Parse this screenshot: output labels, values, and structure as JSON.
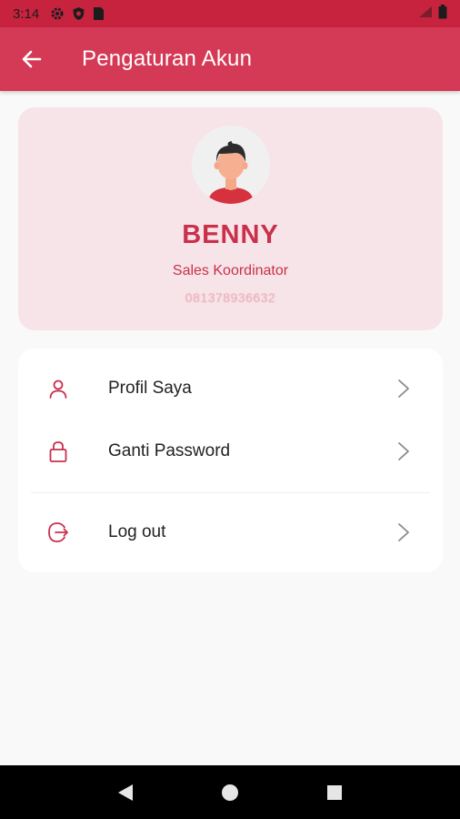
{
  "status_bar": {
    "time": "3:14",
    "icons": [
      "settings-icon",
      "shield-icon",
      "sim-icon",
      "signal-icon",
      "battery-icon"
    ]
  },
  "app_bar": {
    "title": "Pengaturan Akun",
    "back_icon": "arrow-left-icon"
  },
  "profile": {
    "name": "BENNY",
    "role": "Sales Koordinator",
    "phone": "081378936632",
    "avatar_icon": "person-avatar-icon"
  },
  "menu": {
    "items": [
      {
        "label": "Profil Saya",
        "icon": "user-icon"
      },
      {
        "label": "Ganti Password",
        "icon": "lock-icon"
      },
      {
        "label": "Log out",
        "icon": "logout-icon"
      }
    ]
  },
  "nav_bar": {
    "buttons": [
      "back-triangle-icon",
      "home-circle-icon",
      "recents-square-icon"
    ]
  },
  "colors": {
    "status_bar": "#c7233f",
    "app_bar": "#d43a55",
    "accent": "#c9304c",
    "profile_card_bg": "#f7e4e8",
    "page_bg": "#f9f9f9"
  }
}
